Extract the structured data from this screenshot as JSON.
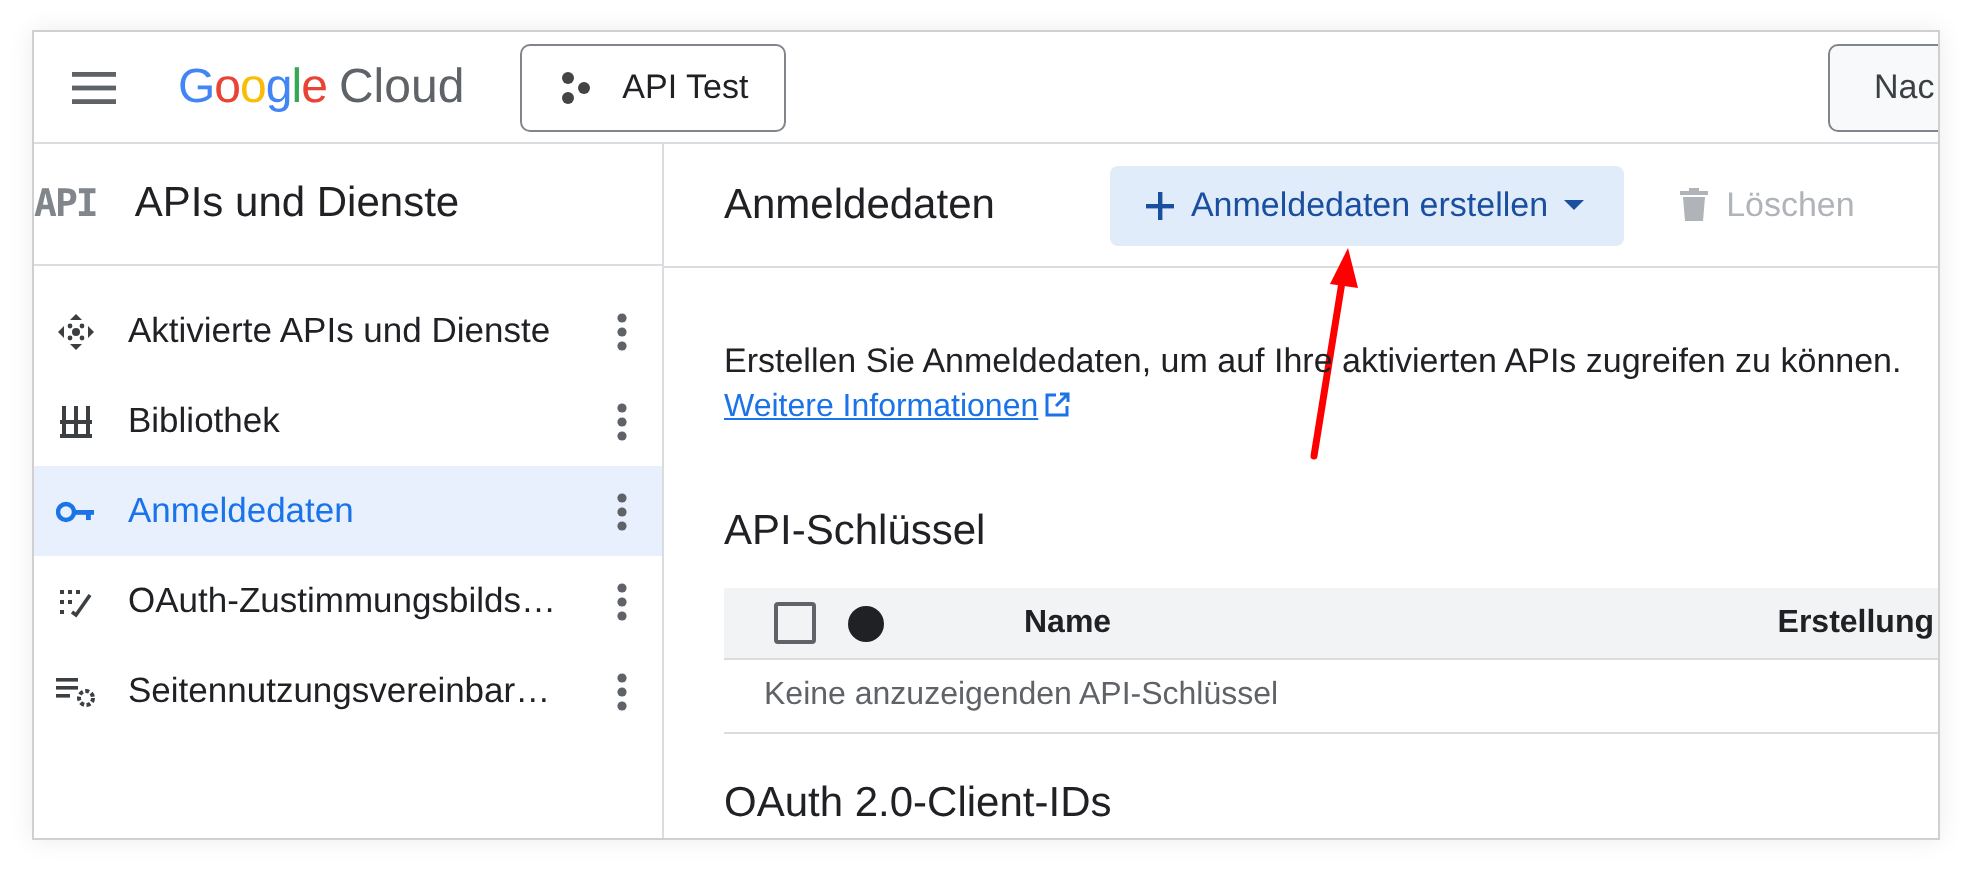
{
  "header": {
    "logo": {
      "brand": "Google",
      "product": "Cloud"
    },
    "project_button": "API Test",
    "right_button": "Nac"
  },
  "sidebar": {
    "title_badge": "API",
    "title": "APIs und Dienste",
    "items": [
      {
        "label": "Aktivierte APIs und Dienste",
        "selected": false
      },
      {
        "label": "Bibliothek",
        "selected": false
      },
      {
        "label": "Anmeldedaten",
        "selected": true
      },
      {
        "label": "OAuth-Zustimmungsbilds…",
        "selected": false
      },
      {
        "label": "Seitennutzungsvereinbar…",
        "selected": false
      }
    ]
  },
  "toolbar": {
    "title": "Anmeldedaten",
    "create_button": "Anmeldedaten erstellen",
    "delete_button": {
      "label": "Löschen",
      "disabled": true
    }
  },
  "intro": {
    "text": "Erstellen Sie Anmeldedaten, um auf Ihre aktivierten APIs zugreifen zu können.",
    "link": "Weitere Informationen"
  },
  "api_keys": {
    "heading": "API-Schlüssel",
    "select_all_checked": false,
    "columns": [
      "Name",
      "Erstellung"
    ],
    "empty_message": "Keine anzuzeigenden API-Schlüssel"
  },
  "oauth": {
    "heading": "OAuth 2.0-Client-IDs"
  }
}
